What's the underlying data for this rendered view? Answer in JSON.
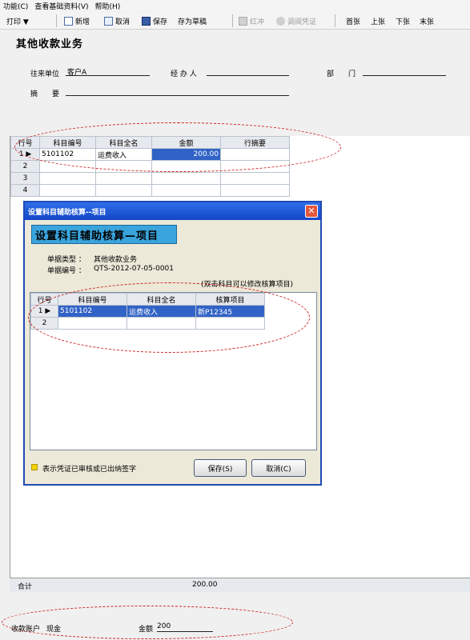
{
  "menu": [
    "功能(C)",
    "查看基础资料(V)",
    "帮助(H)"
  ],
  "toolbar": {
    "print": "打印 ▼",
    "new": "新增",
    "cancel": "取消",
    "save": "保存",
    "save_draft": "存为草稿",
    "red": "红冲",
    "recall": "调阅凭证",
    "first": "首张",
    "prev": "上张",
    "next": "下张",
    "last": "末张"
  },
  "page_title": "其他收款业务",
  "form": {
    "unit_label": "往来单位",
    "unit_value": "客户A",
    "handler_label": "经 办 人",
    "dept_label": "部　　门",
    "summary_label": "摘　　要"
  },
  "main_table": {
    "headers": [
      "行号",
      "科目编号",
      "科目全名",
      "金额",
      "行摘要"
    ],
    "row1": {
      "no": "1",
      "code": "5101102",
      "name": "运费收入",
      "amount": "200.00"
    },
    "row_numbers": [
      "2",
      "3",
      "4"
    ]
  },
  "footer": {
    "total_label": "合计",
    "total_value": "200.00",
    "account_label": "收款账户",
    "account_value": "现金",
    "amount_label": "金额",
    "amount_value": "200"
  },
  "dialog": {
    "title": "设置科目辅助核算--项目",
    "banner": "设置科目辅助核算—项目",
    "doc_type_label": "单据类型 ：",
    "doc_type_value": "其他收款业务",
    "doc_no_label": "单据编号 ：",
    "doc_no_value": "QTS-2012-07-05-0001",
    "hint": "(双击科目可以修改核算项目)",
    "headers": [
      "行号",
      "科目编号",
      "科目全名",
      "核算项目"
    ],
    "row1": {
      "no": "1",
      "code": "5101102",
      "name": "运费收入",
      "item": "新P12345"
    },
    "row2_no": "2",
    "legend": "表示凭证已审核或已出纳签字",
    "ok": "保存(S)",
    "cancel": "取消(C)"
  }
}
